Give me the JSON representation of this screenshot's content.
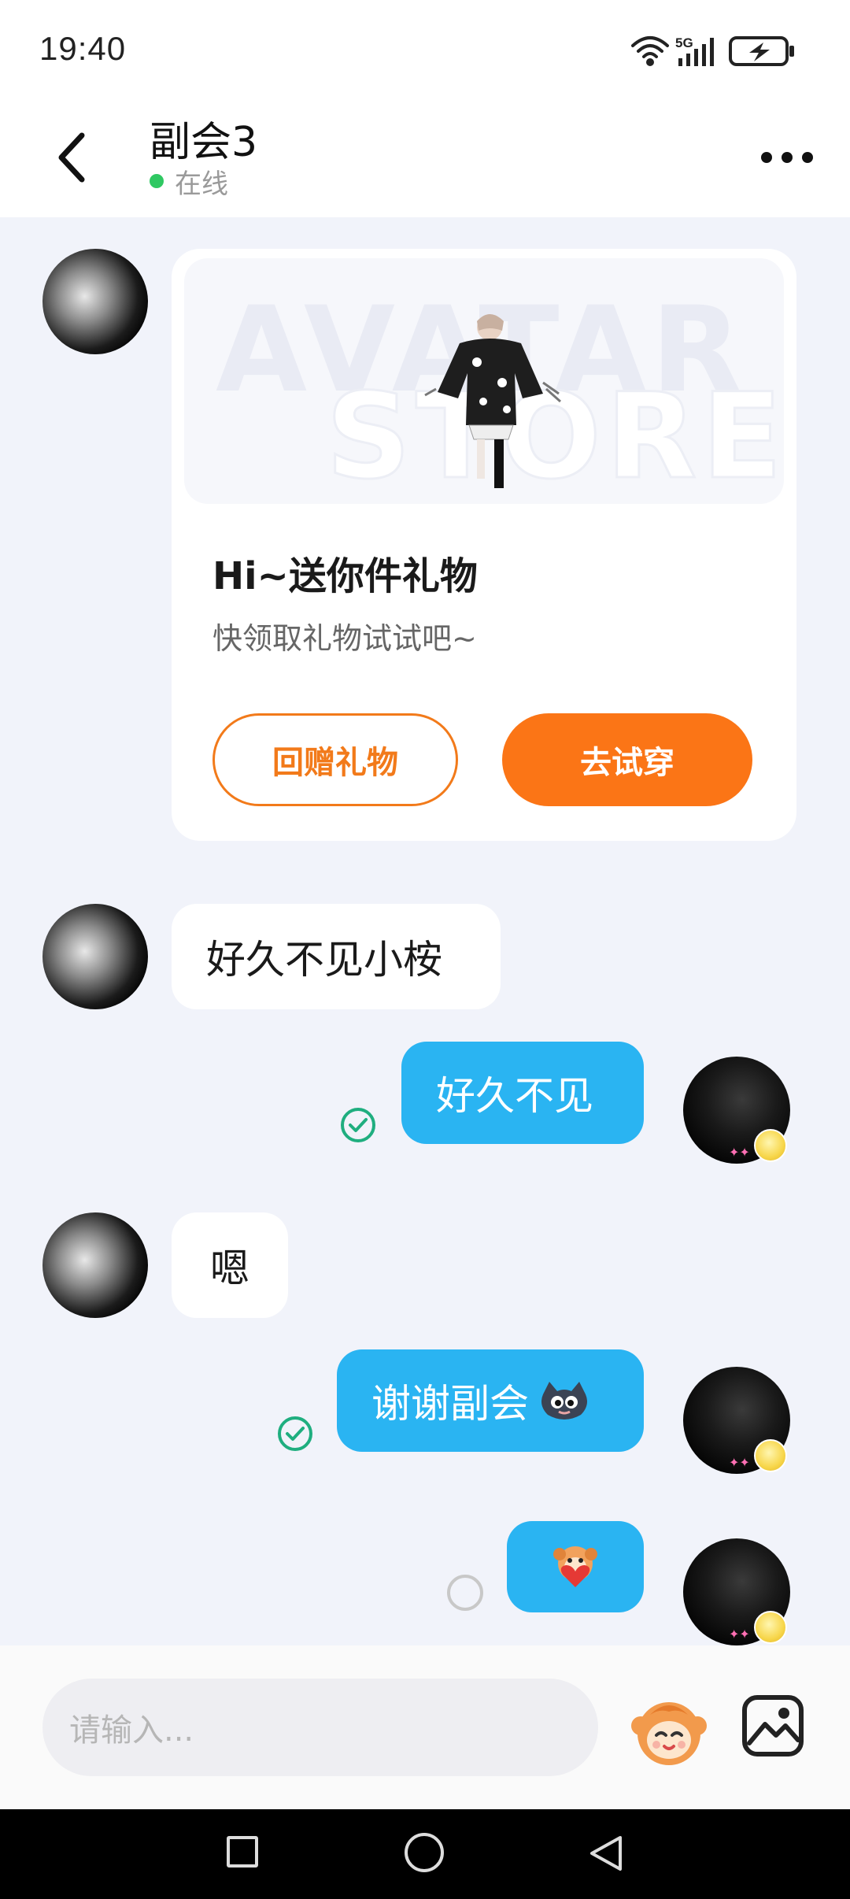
{
  "status_bar": {
    "time": "19:40",
    "network": "5G"
  },
  "header": {
    "title": "副会3",
    "presence": "在线"
  },
  "gift_card": {
    "banner_word_1": "AVATAR",
    "banner_word_2": "STORE",
    "title": "Hi~送你件礼物",
    "subtitle": "快领取礼物试试吧~",
    "return_gift_label": "回赠礼物",
    "try_on_label": "去试穿"
  },
  "messages": [
    {
      "side": "left",
      "text": "好久不见小桉"
    },
    {
      "side": "right",
      "text": "好久不见",
      "status": "read"
    },
    {
      "side": "left",
      "text": "嗯"
    },
    {
      "side": "right",
      "text": "谢谢副会",
      "emoji": "cat-face-sticker",
      "status": "read"
    },
    {
      "side": "right",
      "emoji": "heart-monkey-sticker",
      "status": "pending"
    }
  ],
  "input": {
    "placeholder": "请输入..."
  },
  "colors": {
    "accent_orange": "#fb7516",
    "bubble_blue": "#2ab4f2",
    "online_green": "#2fc862",
    "read_green": "#1fae7f"
  }
}
